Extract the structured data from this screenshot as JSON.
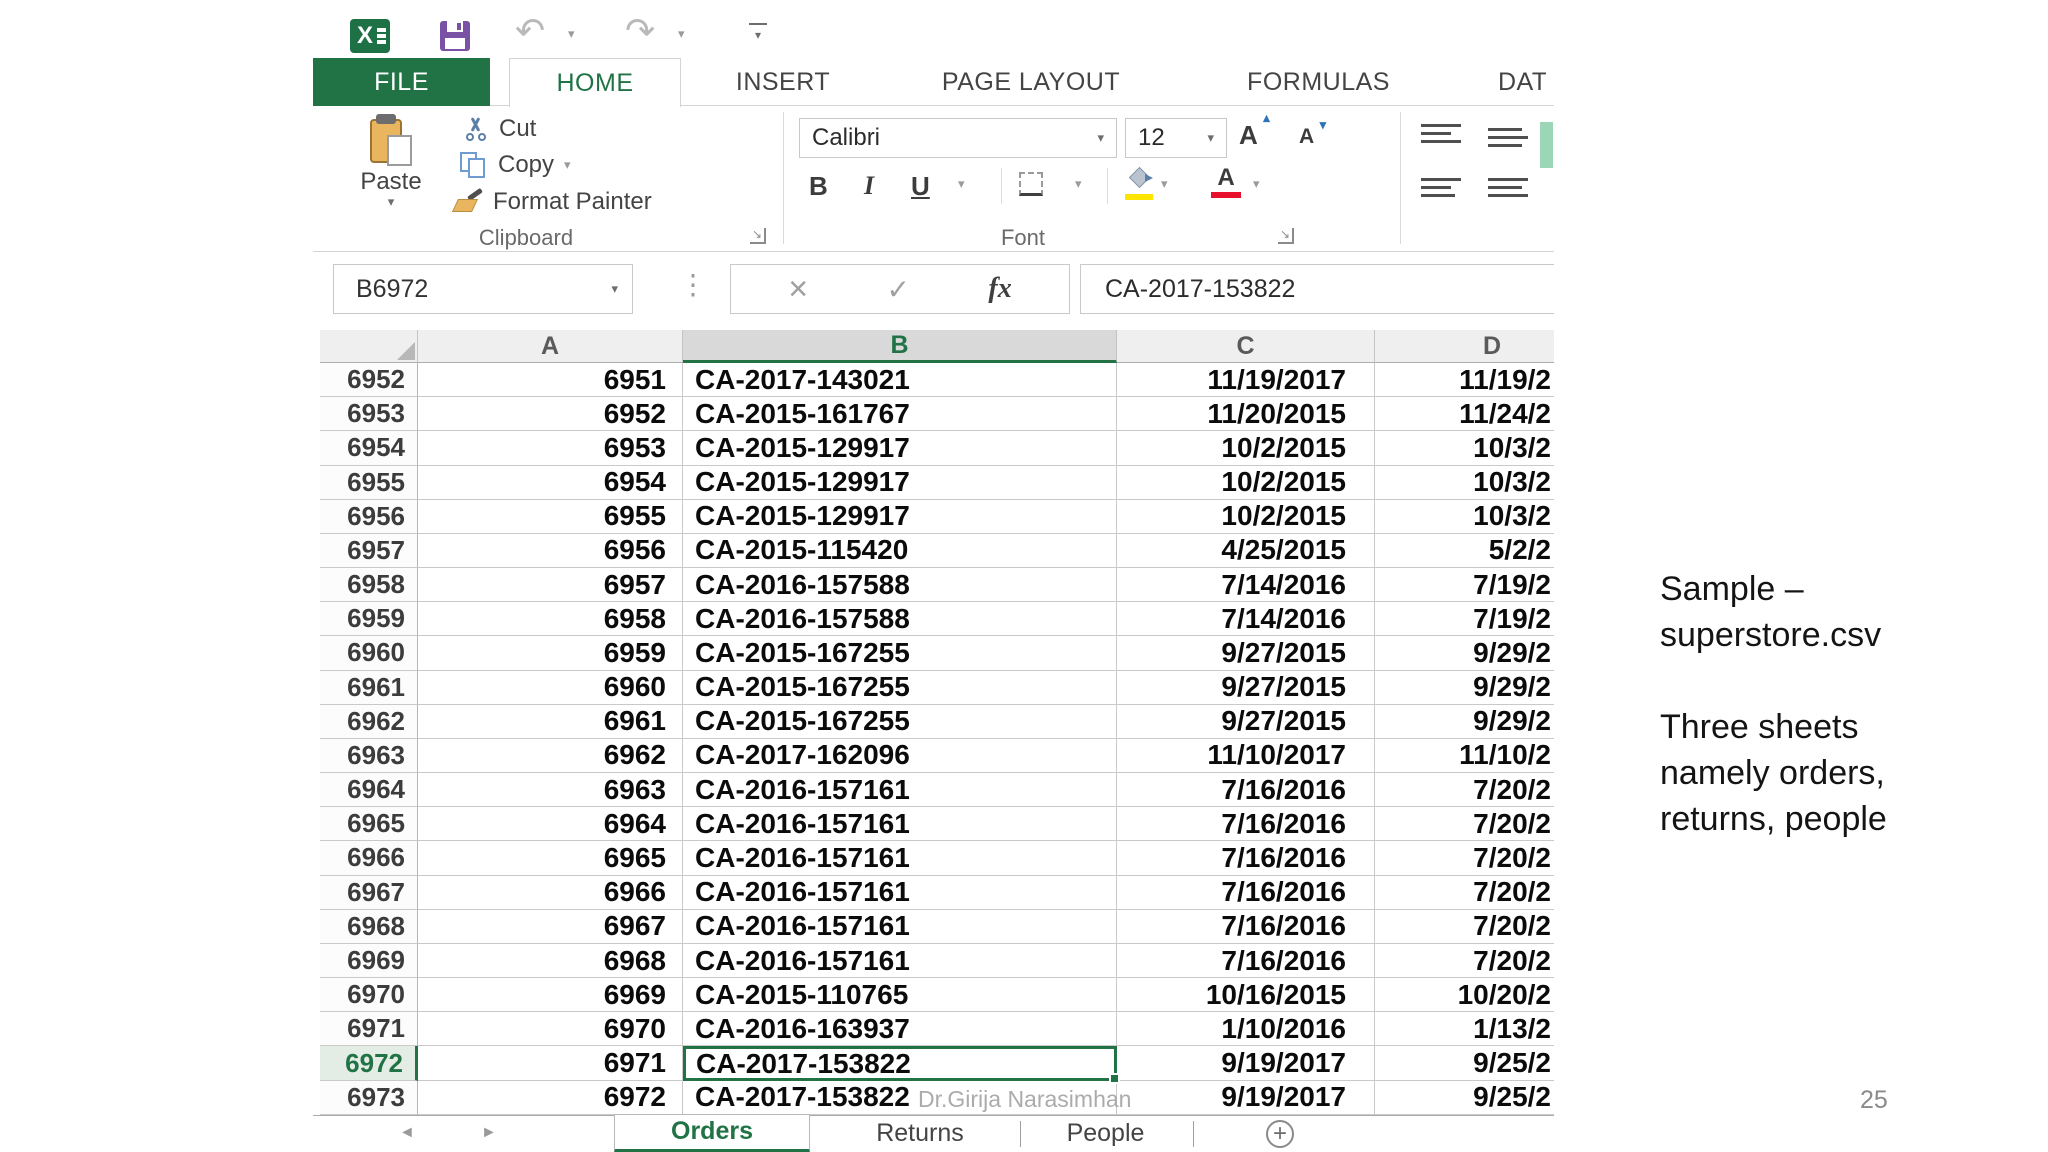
{
  "slide": {
    "notes": [
      "Sample –",
      "superstore.csv",
      "",
      "Three sheets",
      "namely orders,",
      "returns, people"
    ],
    "watermark": "Dr.Girija Narasimhan",
    "page_number": "25"
  },
  "icons": {
    "excel_logo_letter": "X",
    "undo": "↶",
    "redo": "↷",
    "dropdown": "▾",
    "grow_caret": "▴",
    "shrink_caret": "▾",
    "dots": "⋮",
    "cancel": "×",
    "enter": "✓",
    "fx": "fx",
    "launcher": "↘",
    "nav_left": "◄",
    "nav_right": "►",
    "new_sheet": "+",
    "letter_a": "A"
  },
  "excel": {
    "tabs": {
      "file": "FILE",
      "home": "HOME",
      "insert": "INSERT",
      "page_layout": "PAGE LAYOUT",
      "formulas": "FORMULAS",
      "data_clipped": "DAT"
    },
    "clipboard_group": {
      "paste": "Paste",
      "cut": "Cut",
      "copy": "Copy",
      "format_painter": "Format Painter",
      "label": "Clipboard"
    },
    "font_group": {
      "font_name": "Calibri",
      "font_size": "12",
      "bold": "B",
      "italic": "I",
      "underline": "U",
      "label": "Font"
    },
    "formula_bar": {
      "name_box": "B6972",
      "value": "CA-2017-153822"
    },
    "grid": {
      "col_headers": [
        "A",
        "B",
        "C",
        "D"
      ],
      "selected_row": "6972",
      "selected_col": "B",
      "rows": [
        {
          "num": "6952",
          "a": "6951",
          "b": "CA-2017-143021",
          "c": "11/19/2017",
          "d": "11/19/2"
        },
        {
          "num": "6953",
          "a": "6952",
          "b": "CA-2015-161767",
          "c": "11/20/2015",
          "d": "11/24/2"
        },
        {
          "num": "6954",
          "a": "6953",
          "b": "CA-2015-129917",
          "c": "10/2/2015",
          "d": "10/3/2"
        },
        {
          "num": "6955",
          "a": "6954",
          "b": "CA-2015-129917",
          "c": "10/2/2015",
          "d": "10/3/2"
        },
        {
          "num": "6956",
          "a": "6955",
          "b": "CA-2015-129917",
          "c": "10/2/2015",
          "d": "10/3/2"
        },
        {
          "num": "6957",
          "a": "6956",
          "b": "CA-2015-115420",
          "c": "4/25/2015",
          "d": "5/2/2"
        },
        {
          "num": "6958",
          "a": "6957",
          "b": "CA-2016-157588",
          "c": "7/14/2016",
          "d": "7/19/2"
        },
        {
          "num": "6959",
          "a": "6958",
          "b": "CA-2016-157588",
          "c": "7/14/2016",
          "d": "7/19/2"
        },
        {
          "num": "6960",
          "a": "6959",
          "b": "CA-2015-167255",
          "c": "9/27/2015",
          "d": "9/29/2"
        },
        {
          "num": "6961",
          "a": "6960",
          "b": "CA-2015-167255",
          "c": "9/27/2015",
          "d": "9/29/2"
        },
        {
          "num": "6962",
          "a": "6961",
          "b": "CA-2015-167255",
          "c": "9/27/2015",
          "d": "9/29/2"
        },
        {
          "num": "6963",
          "a": "6962",
          "b": "CA-2017-162096",
          "c": "11/10/2017",
          "d": "11/10/2"
        },
        {
          "num": "6964",
          "a": "6963",
          "b": "CA-2016-157161",
          "c": "7/16/2016",
          "d": "7/20/2"
        },
        {
          "num": "6965",
          "a": "6964",
          "b": "CA-2016-157161",
          "c": "7/16/2016",
          "d": "7/20/2"
        },
        {
          "num": "6966",
          "a": "6965",
          "b": "CA-2016-157161",
          "c": "7/16/2016",
          "d": "7/20/2"
        },
        {
          "num": "6967",
          "a": "6966",
          "b": "CA-2016-157161",
          "c": "7/16/2016",
          "d": "7/20/2"
        },
        {
          "num": "6968",
          "a": "6967",
          "b": "CA-2016-157161",
          "c": "7/16/2016",
          "d": "7/20/2"
        },
        {
          "num": "6969",
          "a": "6968",
          "b": "CA-2016-157161",
          "c": "7/16/2016",
          "d": "7/20/2"
        },
        {
          "num": "6970",
          "a": "6969",
          "b": "CA-2015-110765",
          "c": "10/16/2015",
          "d": "10/20/2"
        },
        {
          "num": "6971",
          "a": "6970",
          "b": "CA-2016-163937",
          "c": "1/10/2016",
          "d": "1/13/2"
        },
        {
          "num": "6972",
          "a": "6971",
          "b": "CA-2017-153822",
          "c": "9/19/2017",
          "d": "9/25/2"
        },
        {
          "num": "6973",
          "a": "6972",
          "b": "CA-2017-153822",
          "c": "9/19/2017",
          "d": "9/25/2"
        }
      ]
    },
    "sheet_bar": {
      "tabs": [
        "Orders",
        "Returns",
        "People"
      ],
      "active": "Orders"
    },
    "colors": {
      "excel_green": "#217346",
      "save_purple": "#7a52a5",
      "fill_yellow": "#ffe400",
      "font_red": "#e8112d",
      "green_bar": "#9bd6b6"
    }
  }
}
